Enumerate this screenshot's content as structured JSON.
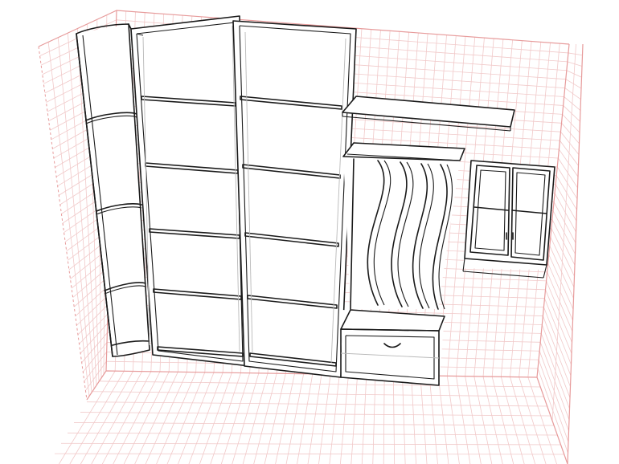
{
  "scene": {
    "view": "3d-furniture-layout",
    "room": {
      "grid": "on",
      "wall_color": "#ffffff",
      "grid_color": "#f1c9c9",
      "edge_color": "#e79b9b"
    },
    "furniture": [
      {
        "id": "corner-shelf",
        "kind": "corner open shelf unit"
      },
      {
        "id": "bookcase-left",
        "kind": "bookcase"
      },
      {
        "id": "bookcase-right",
        "kind": "bookcase"
      },
      {
        "id": "top-shelf",
        "kind": "wall shelf"
      },
      {
        "id": "wave-panel",
        "kind": "wave hallway panel"
      },
      {
        "id": "shoe-bench",
        "kind": "bench with drawer"
      },
      {
        "id": "wall-cabinet",
        "kind": "glass door wall cabinet"
      }
    ],
    "line_color": "#1a1a1a"
  }
}
